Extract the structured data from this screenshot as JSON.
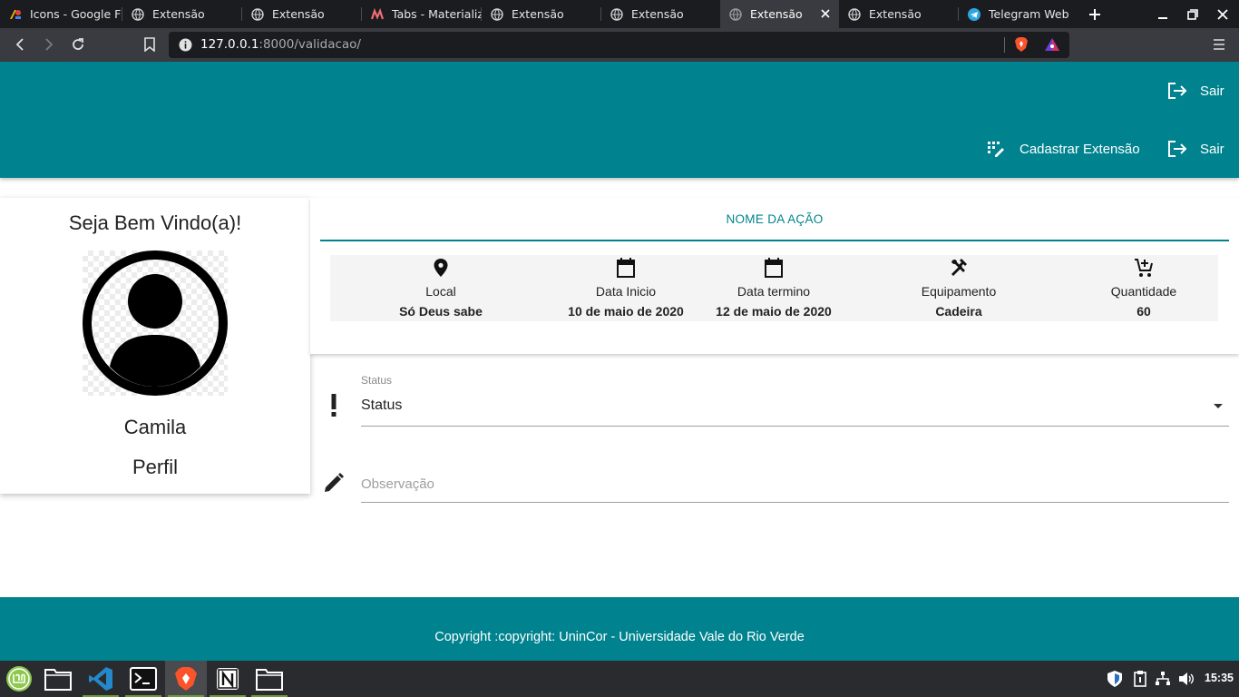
{
  "browser": {
    "tabs": [
      {
        "title": "Icons - Google F",
        "icon": "google-fonts-icon",
        "active": false
      },
      {
        "title": "Extensão",
        "icon": "globe-icon",
        "active": false
      },
      {
        "title": "Extensão",
        "icon": "globe-icon",
        "active": false
      },
      {
        "title": "Tabs - Materializ",
        "icon": "materialize-icon",
        "active": false
      },
      {
        "title": "Extensão",
        "icon": "globe-icon",
        "active": false
      },
      {
        "title": "Extensão",
        "icon": "globe-icon",
        "active": false
      },
      {
        "title": "Extensão",
        "icon": "globe-icon",
        "active": true
      },
      {
        "title": "Extensão",
        "icon": "globe-icon",
        "active": false
      },
      {
        "title": "Telegram Web",
        "icon": "telegram-icon",
        "active": false
      }
    ],
    "url_host": "127.0.0.1",
    "url_rest": ":8000/validacao/"
  },
  "header": {
    "top_link": "Sair",
    "nav": {
      "register_label": "Cadastrar Extensão",
      "logout_label": "Sair"
    }
  },
  "profile": {
    "welcome": "Seja Bem Vindo(a)!",
    "name": "Camila",
    "link": "Perfil"
  },
  "action": {
    "tab_label": "NOME DA AÇÃO",
    "info": [
      {
        "icon": "location-pin-icon",
        "label": "Local",
        "value": "Só Deus sabe"
      },
      {
        "icon": "calendar-icon",
        "label": "Data Inicio",
        "value": "10 de maio de 2020"
      },
      {
        "icon": "calendar-icon",
        "label": "Data termino",
        "value": "12 de maio de 2020"
      },
      {
        "icon": "tools-icon",
        "label": "Equipamento",
        "value": "Cadeira"
      },
      {
        "icon": "add-cart-icon",
        "label": "Quantidade",
        "value": "60"
      }
    ]
  },
  "form": {
    "status_label": "Status",
    "status_value": "Status",
    "observation_placeholder": "Observação"
  },
  "footer": {
    "copyright": "Copyright :copyright: UninCor - Universidade Vale do Rio Verde"
  },
  "taskbar": {
    "clock": "15:35"
  },
  "colors": {
    "primary": "#00838f",
    "browser_dark": "#1b1c20",
    "browser_toolbar": "#3a3b40"
  }
}
